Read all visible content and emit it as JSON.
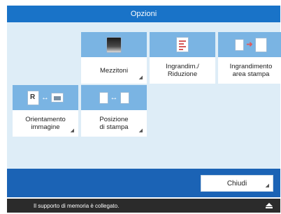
{
  "header": {
    "title": "Opzioni"
  },
  "tiles": [
    {
      "label": "Mezzitoni",
      "icon": "halftone-icon"
    },
    {
      "label": "Ingrandim./\nRiduzione",
      "icon": "enlarge-reduce-icon"
    },
    {
      "label": "Ingrandimento\narea stampa",
      "icon": "enlarge-print-area-icon"
    },
    {
      "label": "Orientamento\nimmagine",
      "icon": "image-orientation-icon"
    },
    {
      "label": "Posizione\ndi stampa",
      "icon": "print-position-icon"
    }
  ],
  "footer": {
    "close_label": "Chiudi"
  },
  "status": {
    "text": "Il supporto di memoria è collegato."
  },
  "colors": {
    "title_bar": "#1973c8",
    "panel": "#deedf7",
    "tile_icon_area": "#7ab4e3",
    "footer_bar": "#1b63b5",
    "status_bar": "#2b2b2b"
  }
}
